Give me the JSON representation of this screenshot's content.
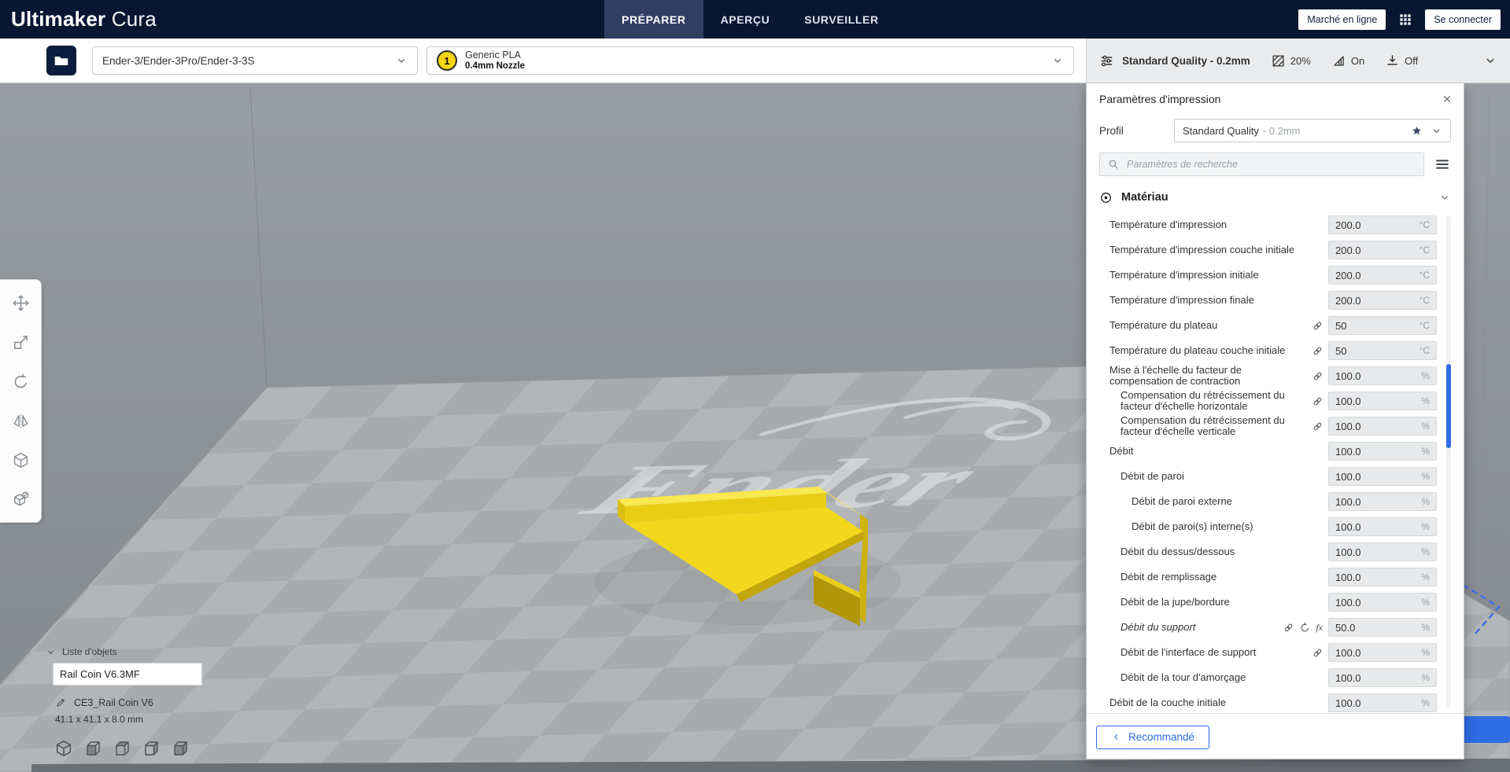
{
  "app": {
    "brand_bold": "Ultimaker",
    "brand_light": "Cura"
  },
  "topbar": {
    "tabs": [
      {
        "label": "PRÉPARER",
        "active": true
      },
      {
        "label": "APERÇU",
        "active": false
      },
      {
        "label": "SURVEILLER",
        "active": false
      }
    ],
    "marketplace_button": "Marché en ligne",
    "sign_in_button": "Se connecter"
  },
  "toolbar": {
    "printer_name": "Ender-3/Ender-3Pro/Ender-3-3S",
    "extruder_number": "1",
    "material_name": "Generic PLA",
    "nozzle_size": "0.4mm Nozzle",
    "profile_summary": "Standard Quality - 0.2mm",
    "infill_value": "20%",
    "support_value": "On",
    "adhesion_value": "Off"
  },
  "object_list": {
    "header": "Liste d'objets",
    "name_field_value": "Rail Coin V6.3MF",
    "item_name": "CE3_Rail Coin V6",
    "item_size": "41.1 x 41.1 x 8.0 mm"
  },
  "panel": {
    "title": "Paramètres d'impression",
    "profile_label": "Profil",
    "profile_value": "Standard Quality",
    "profile_suffix": "- 0.2mm",
    "search_placeholder": "Paramètres de recherche",
    "category_title": "Matériau",
    "footer_button": "Recommandé",
    "fx_label": "fx",
    "rows": [
      {
        "label": "Température d'impression",
        "value": "200.0",
        "unit": "°C"
      },
      {
        "label": "Température d'impression couche initiale",
        "value": "200.0",
        "unit": "°C"
      },
      {
        "label": "Température d'impression initiale",
        "value": "200.0",
        "unit": "°C"
      },
      {
        "label": "Température d'impression finale",
        "value": "200.0",
        "unit": "°C"
      },
      {
        "label": "Température du plateau",
        "value": "50",
        "unit": "°C",
        "link": true
      },
      {
        "label": "Température du plateau couche initiale",
        "value": "50",
        "unit": "°C",
        "link": true
      },
      {
        "label": "Mise à l'échelle du facteur de compensation de contraction",
        "value": "100.0",
        "unit": "%",
        "link": true
      },
      {
        "label": "Compensation du rétrécissement du facteur d'échelle horizontale",
        "value": "100.0",
        "unit": "%",
        "link": true
      },
      {
        "label": "Compensation du rétrécissement du facteur d'échelle verticale",
        "value": "100.0",
        "unit": "%",
        "link": true
      },
      {
        "label": "Débit",
        "value": "100.0",
        "unit": "%"
      },
      {
        "label": "Débit de paroi",
        "value": "100.0",
        "unit": "%"
      },
      {
        "label": "Débit de paroi externe",
        "value": "100.0",
        "unit": "%"
      },
      {
        "label": "Débit de paroi(s) interne(s)",
        "value": "100.0",
        "unit": "%"
      },
      {
        "label": "Débit du dessus/dessous",
        "value": "100.0",
        "unit": "%"
      },
      {
        "label": "Débit de remplissage",
        "value": "100.0",
        "unit": "%"
      },
      {
        "label": "Débit de la jupe/bordure",
        "value": "100.0",
        "unit": "%"
      },
      {
        "label": "Débit du support",
        "value": "50.0",
        "unit": "%",
        "link": true,
        "revert": true,
        "fx": true,
        "italic": true
      },
      {
        "label": "Débit de l'interface de support",
        "value": "100.0",
        "unit": "%",
        "link": true
      },
      {
        "label": "Débit de la tour d'amorçage",
        "value": "100.0",
        "unit": "%"
      },
      {
        "label": "Débit de la couche initiale",
        "value": "100.0",
        "unit": "%"
      }
    ]
  },
  "colors": {
    "accent_blue": "#2e6de4",
    "topbar_bg": "#081632",
    "active_tab_bg": "#323f63",
    "model_yellow": "#f2d71c",
    "summary_bg": "#e9ebed"
  },
  "icons": {
    "folder": "filled folder shape",
    "apps-grid": "3x3 dot grid",
    "chevron-down": "v chevron",
    "chevron-left": "< chevron",
    "close": "x cross",
    "search": "magnifier",
    "menu": "hamburger 3 lines",
    "link": "chain links",
    "revert": "circular undo arrow",
    "function": "fx",
    "star": "filled 5-point star",
    "material-category": "filament spool",
    "sliders": "3 sliders",
    "infill": "hatched square",
    "support": "support triangle with pillars",
    "adhesion": "arrow down onto plate",
    "pencil": "edit pencil",
    "move": "4-way cross arrows",
    "scale": "box with diagonal arrow",
    "rotate": "circular arrow",
    "mirror": "twin mirrored triangles",
    "per-model-settings": "iso cube",
    "support-blocker": "cube with slash",
    "view-3d": "isometric cube",
    "view-front": "cube front face",
    "view-top": "cube top face",
    "view-side": "cube side face"
  }
}
